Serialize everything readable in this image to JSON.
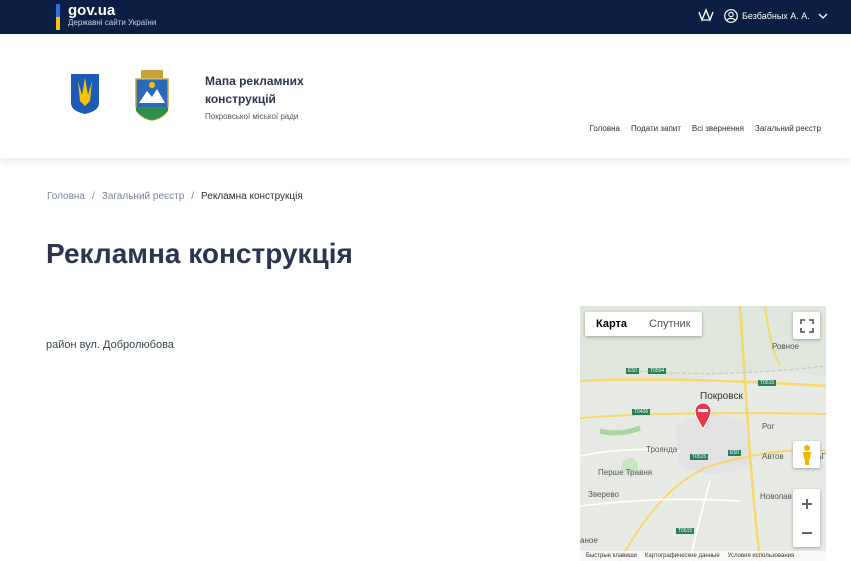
{
  "govbar": {
    "title": "gov.ua",
    "subtitle": "Державні сайти України",
    "user_name": "Безбабных А. А.",
    "colors": {
      "background": "#0b1e44",
      "flag_blue": "#2f6fdc",
      "flag_yellow": "#f6c400"
    }
  },
  "header": {
    "site_title_line1": "Мапа рекламних",
    "site_title_line2": "конструкцій",
    "site_subtitle": "Покровської міської ради",
    "nav": [
      "Головна",
      "Подати запит",
      "Всі звернення",
      "Загальний реєстр"
    ]
  },
  "breadcrumb": {
    "items": [
      "Головна",
      "Загальний реєстр"
    ],
    "separator": "/",
    "current": "Рекламна конструкція"
  },
  "page": {
    "title": "Рекламна конструкція",
    "address": "район вул. Добролюбова"
  },
  "map": {
    "type_buttons": [
      "Карта",
      "Спутник"
    ],
    "selected_type": "Карта",
    "labels": {
      "pokrovsk": "Покровск",
      "rovnoe": "Ровное",
      "rog": "Рог",
      "troyanda": "Троянда",
      "pershe": "Перше Травня",
      "zverevo": "Зверево",
      "novopav": "Новопав",
      "avto": "Автов",
      "ag": "АГ",
      "anoe": "аное"
    },
    "road_tags": [
      "E50",
      "T0504",
      "T0515",
      "T0406",
      "T0515",
      "E50",
      "T0515"
    ],
    "footer": [
      "Быстрые клавиши",
      "Картографические данные",
      "Условия использования"
    ],
    "icons": {
      "fullscreen": "fullscreen-icon",
      "pegman": "pegman-icon",
      "zoom_in": "plus-icon",
      "zoom_out": "minus-icon",
      "marker": "map-marker-icon"
    }
  }
}
